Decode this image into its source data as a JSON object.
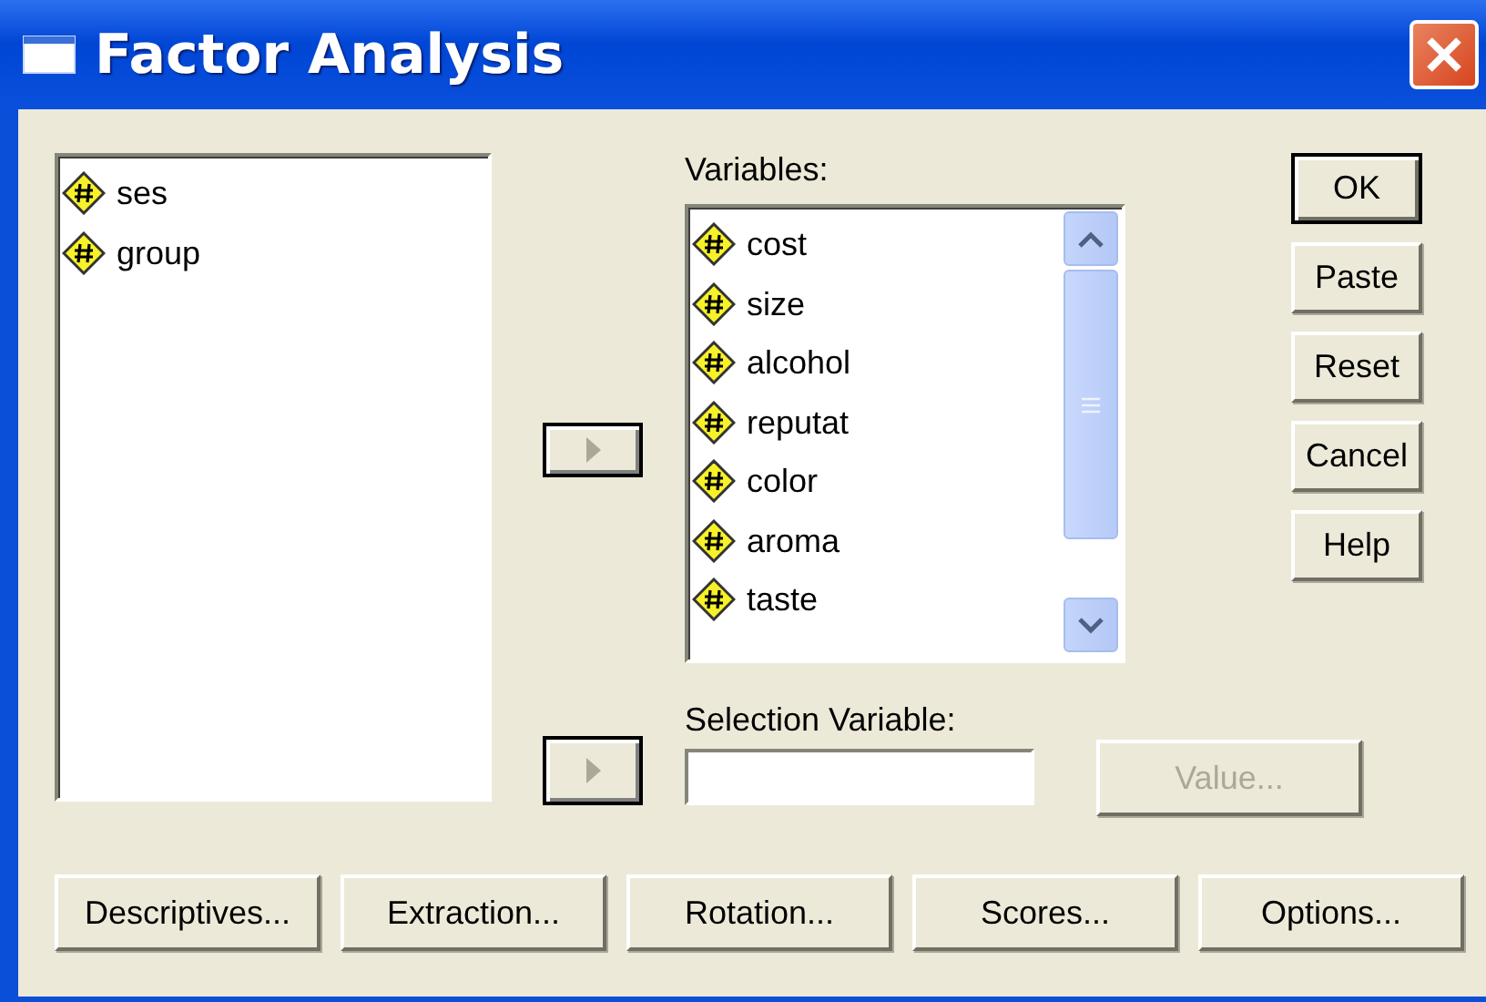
{
  "window": {
    "title": "Factor Analysis"
  },
  "source_list": {
    "items": [
      {
        "name": "ses"
      },
      {
        "name": "group"
      }
    ]
  },
  "variables": {
    "label": "Variables:",
    "items": [
      {
        "name": "cost"
      },
      {
        "name": "size"
      },
      {
        "name": "alcohol"
      },
      {
        "name": "reputat"
      },
      {
        "name": "color"
      },
      {
        "name": "aroma"
      },
      {
        "name": "taste"
      }
    ]
  },
  "selection_variable": {
    "label": "Selection Variable:",
    "value_button": {
      "label": "Value...",
      "disabled": true
    }
  },
  "side_buttons": [
    {
      "label": "OK",
      "default": true
    },
    {
      "label": "Paste",
      "default": false
    },
    {
      "label": "Reset",
      "default": false
    },
    {
      "label": "Cancel",
      "default": false
    },
    {
      "label": "Help",
      "default": false
    }
  ],
  "bottom_buttons": [
    {
      "label": "Descriptives..."
    },
    {
      "label": "Extraction..."
    },
    {
      "label": "Rotation..."
    },
    {
      "label": "Scores..."
    },
    {
      "label": "Options..."
    }
  ]
}
